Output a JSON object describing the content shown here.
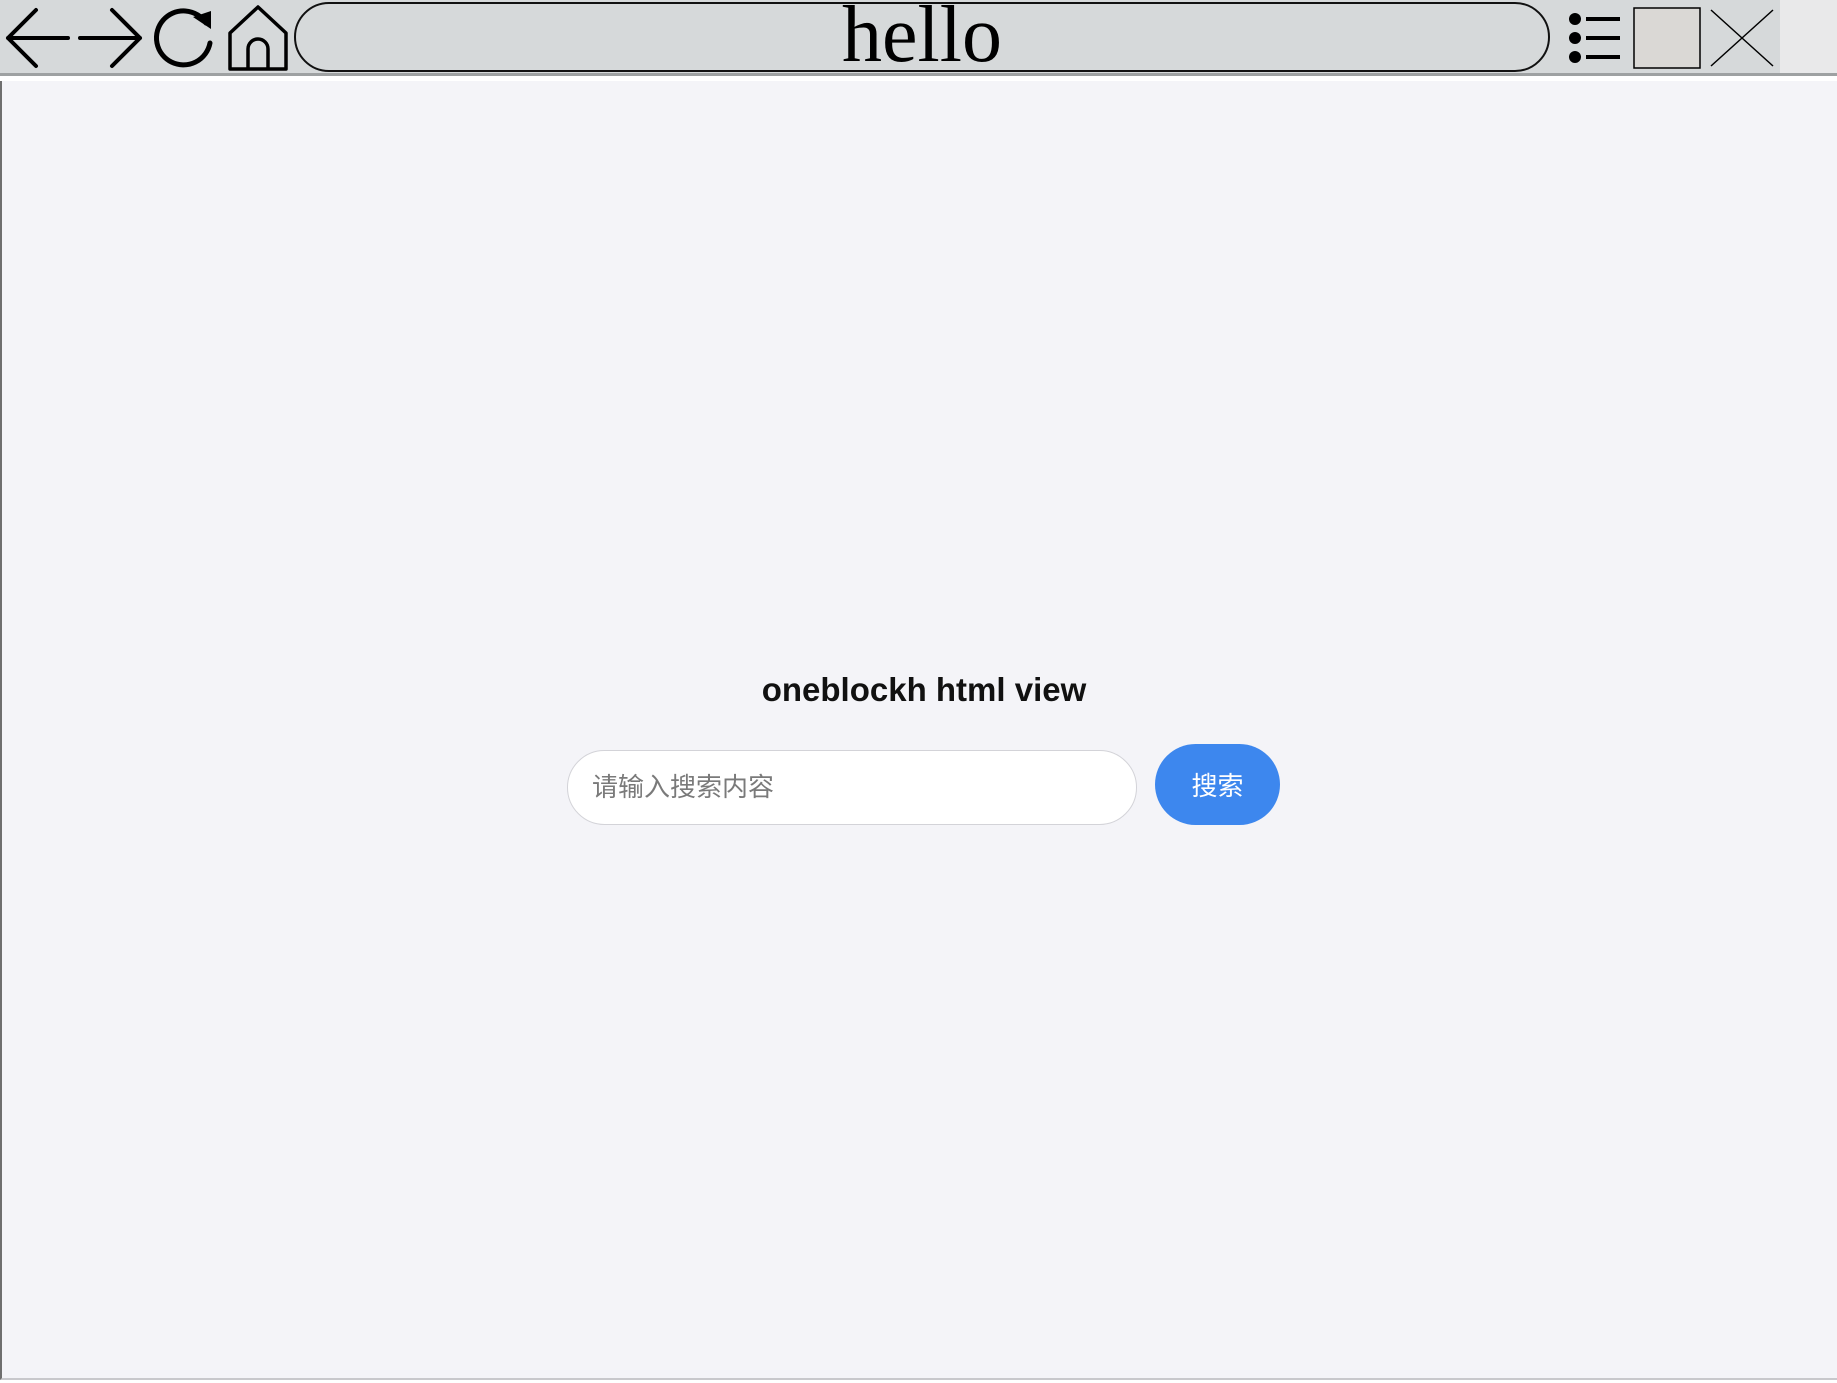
{
  "browser": {
    "address": "hello",
    "icons": {
      "back": "arrow-left-icon",
      "forward": "arrow-right-icon",
      "reload": "reload-icon",
      "home": "home-icon",
      "menu": "list-menu-icon",
      "maximize": "maximize-icon",
      "close": "close-icon"
    }
  },
  "page": {
    "title": "oneblockh html view",
    "search": {
      "placeholder": "请输入搜索内容",
      "value": "",
      "button_label": "搜索"
    }
  },
  "colors": {
    "toolbar_bg": "#d6d9da",
    "page_bg": "#f4f4f8",
    "accent": "#3d87ee"
  }
}
